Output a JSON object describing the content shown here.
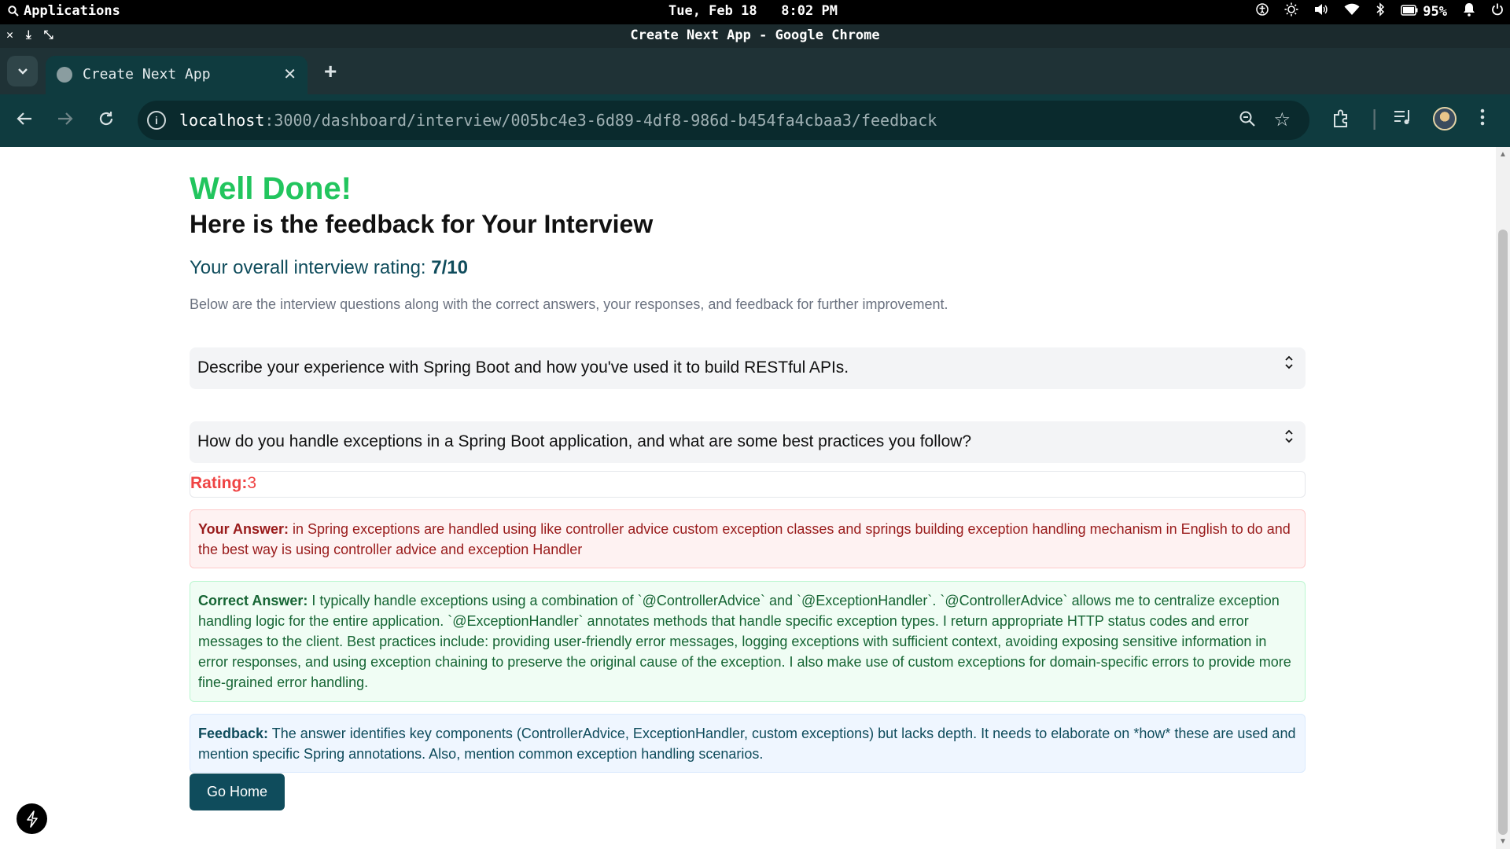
{
  "system_bar": {
    "apps_label": "Applications",
    "clock": "Tue, Feb 18   8:02 PM",
    "battery": "95%"
  },
  "window": {
    "title": "Create Next App - Google Chrome"
  },
  "browser": {
    "tab_title": "Create Next App",
    "url_host": "localhost",
    "url_rest": ":3000/dashboard/interview/005bc4e3-6d89-4df8-986d-b454fa4cbaa3/feedback"
  },
  "page": {
    "heading": "Well Done!",
    "subheading": "Here is the feedback for Your Interview",
    "overall_prefix": "Your overall interview rating: ",
    "overall_value": "7/10",
    "description": "Below are the interview questions along with the correct answers, your responses, and feedback for further improvement.",
    "questions": [
      {
        "text": "Describe your experience with Spring Boot and how you've used it to build RESTful APIs."
      },
      {
        "text": "How do you handle exceptions in a Spring Boot application, and what are some best practices you follow?"
      }
    ],
    "rating_label": "Rating:",
    "rating_value": "3",
    "answer_label": "Your Answer:",
    "answer_text": " in Spring exceptions are handled using like controller advice custom exception classes and springs building exception handling mechanism in English to do and the best way is using controller advice and exception Handler",
    "correct_label": "Correct Answer:",
    "correct_text": " I typically handle exceptions using a combination of `@ControllerAdvice` and `@ExceptionHandler`. `@ControllerAdvice` allows me to centralize exception handling logic for the entire application. `@ExceptionHandler` annotates methods that handle specific exception types. I return appropriate HTTP status codes and error messages to the client. Best practices include: providing user-friendly error messages, logging exceptions with sufficient context, avoiding exposing sensitive information in error responses, and using exception chaining to preserve the original cause of the exception. I also make use of custom exceptions for domain-specific errors to provide more fine-grained error handling.",
    "feedback_label": "Feedback:",
    "feedback_text": " The answer identifies key components (ControllerAdvice, ExceptionHandler, custom exceptions) but lacks depth. It needs to elaborate on *how* these are used and mention specific Spring annotations. Also, mention common exception handling scenarios.",
    "go_home_label": "Go Home"
  },
  "colors": {
    "accent_green": "#22c55e",
    "primary_teal": "#0f4c5c",
    "rating_red": "#ef4444"
  }
}
